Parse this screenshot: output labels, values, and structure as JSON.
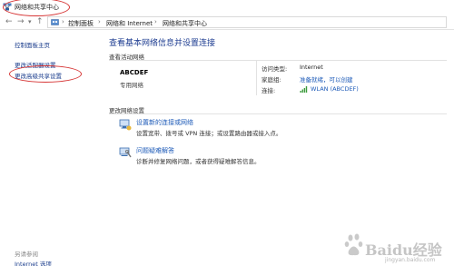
{
  "window": {
    "title": "网络和共享中心"
  },
  "nav": {
    "back": "←",
    "forward": "→",
    "up": "↑",
    "breadcrumbs": [
      "控制面板",
      "网络和 Internet",
      "网络和共享中心"
    ],
    "separator": "›"
  },
  "left": {
    "home": "控制面板主页",
    "adapter": "更改适配器设置",
    "advanced": "更改高级共享设置",
    "seealso": "另请参阅",
    "internet": "Internet 选项"
  },
  "main": {
    "heading": "查看基本网络信息并设置连接",
    "active_section": "查看活动网络",
    "network_name": "ABCDEF",
    "network_type": "专用网络",
    "access_type_label": "访问类型:",
    "access_type_value": "Internet",
    "homegroup_label": "家庭组:",
    "homegroup_value": "准备就绪，可以创建",
    "connection_label": "连接:",
    "connection_value": "WLAN (ABCDEF)",
    "change_section": "更改网络设置",
    "task1_title": "设置新的连接或网络",
    "task1_desc": "设置宽带、拨号或 VPN 连接；或设置路由器或接入点。",
    "task2_title": "问题疑难解答",
    "task2_desc": "诊断并修复网络问题，或者获得疑难解答信息。"
  },
  "watermark": {
    "text": "Baidu经验",
    "sub": "jingyan.baidu.com"
  },
  "colors": {
    "link": "#1e5bb8",
    "heading": "#1e3d91",
    "annotation": "#d63434"
  }
}
